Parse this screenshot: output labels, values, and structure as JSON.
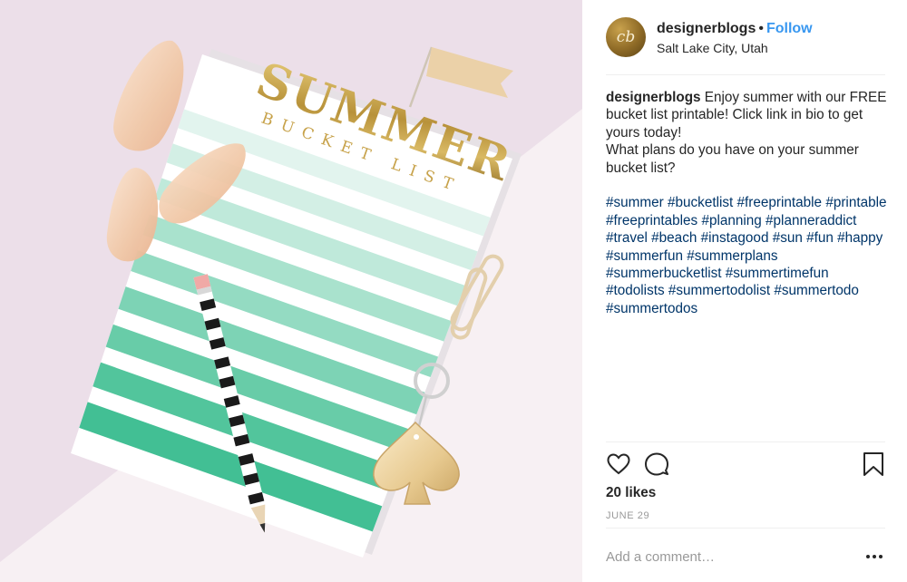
{
  "post": {
    "username": "designerblogs",
    "separator": "•",
    "follow_label": "Follow",
    "location": "Salt Lake City, Utah",
    "avatar_initials": "cb",
    "caption": {
      "username": "designerblogs",
      "text": "Enjoy summer with our FREE bucket list printable! Click link in bio to get yours today!",
      "question": "What plans do you have on your summer bucket list?",
      "hashtags": "#summer #bucketlist #freeprintable #printable #freeprintables #planning #planneraddict #travel #beach #instagood #sun #fun #happy #summerfun #summerplans #summerbucketlist #summertimefun #todolists #summertodolist #summertodo #summertodos"
    },
    "likes": "20 likes",
    "date": "JUNE 29",
    "comment_placeholder": "Add a comment…"
  },
  "photo": {
    "title_main": "SUMMER",
    "title_sub": "BUCKET LIST",
    "background_colors": [
      "#ecdfe9",
      "#f6eff3"
    ],
    "stripe_colors": [
      "#dff3ec",
      "#c5ebdd",
      "#a8e2cd",
      "#8fd9bf",
      "#74d0b1",
      "#5bc8a3",
      "#47c097"
    ],
    "gold": "#c7a24a",
    "flag_color": "#ecd2aa"
  },
  "icons": {
    "like": "heart-icon",
    "comment": "comment-bubble-icon",
    "save": "bookmark-icon",
    "more": "more-options-icon"
  },
  "colors": {
    "link_blue": "#3897f0",
    "hashtag_blue": "#003569",
    "muted_gray": "#999999",
    "divider": "#efefef"
  }
}
